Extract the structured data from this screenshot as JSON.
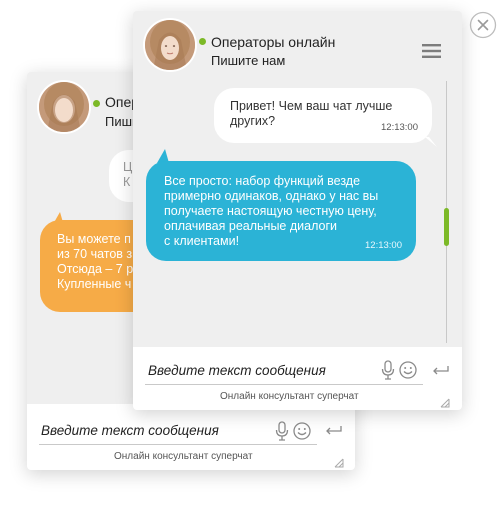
{
  "close_icon": "close-circle-icon",
  "back_widget": {
    "header": {
      "title": "Операторы онлайн",
      "subtitle": "Пишите нам"
    },
    "messages": [
      {
        "from": "user",
        "text": "Ц\nК"
      },
      {
        "from": "operator",
        "text": "Вы можете п\nиз 70 чатов з\nОтсюда – 7 р\nКупленные ч"
      }
    ],
    "input": {
      "placeholder": "Введите текст сообщения"
    },
    "footer": "Онлайн консультант суперчат"
  },
  "front_widget": {
    "header": {
      "title": "Операторы онлайн",
      "subtitle": "Пишите нам",
      "status_color": "#7cb927"
    },
    "messages": [
      {
        "from": "user",
        "text": "Привет! Чем ваш чат лучше\nдругих?",
        "time": "12:13:00"
      },
      {
        "from": "operator",
        "text": "Все просто: набор функций везде\nпримерно одинаков, однако у нас вы\nполучаете настоящую честную цену,\nоплачивая реальные диалоги\nс клиентами!",
        "time": "12:13:00"
      }
    ],
    "input": {
      "placeholder": "Введите текст сообщения"
    },
    "footer": "Онлайн консультант суперчат"
  },
  "colors": {
    "operator_bubble": "#2bb3d6",
    "operator_bubble_alt": "#f6ab47",
    "online": "#7cb927"
  }
}
